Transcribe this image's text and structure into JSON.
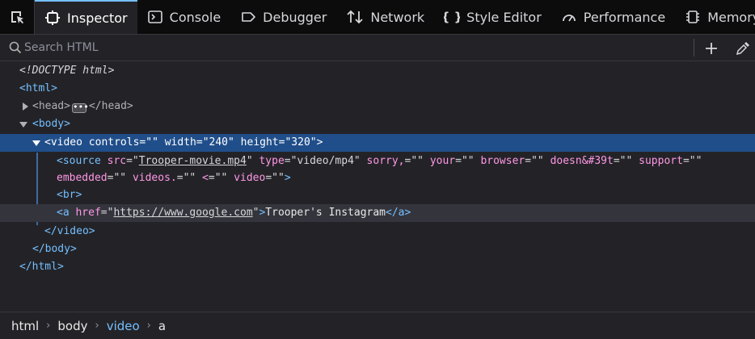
{
  "tabs": [
    {
      "label": "Inspector",
      "icon": "inspector-icon",
      "selected": true
    },
    {
      "label": "Console",
      "icon": "console-icon"
    },
    {
      "label": "Debugger",
      "icon": "debugger-icon"
    },
    {
      "label": "Network",
      "icon": "network-icon"
    },
    {
      "label": "Style Editor",
      "icon": "style-editor-icon"
    },
    {
      "label": "Performance",
      "icon": "performance-icon"
    },
    {
      "label": "Memory",
      "icon": "memory-icon"
    }
  ],
  "search": {
    "placeholder": "Search HTML"
  },
  "colors": {
    "accent": "#75bfff",
    "selected_row": "#204e8a",
    "attr_name": "#ff97e6",
    "background": "#232327"
  },
  "tree": {
    "doctype": "<!DOCTYPE html>",
    "html_open": "<html>",
    "head": {
      "open": "<head>",
      "ellipsis": "•••",
      "close": "</head>"
    },
    "body_open": "<body>",
    "video": {
      "tag_open": "<video",
      "attrs": [
        {
          "name": "controls",
          "value": "\"\""
        },
        {
          "name": "width",
          "value": "\"240\""
        },
        {
          "name": "height",
          "value": "\"320\""
        }
      ],
      "tag_end": ">"
    },
    "source": {
      "tag_open": "<source",
      "src_name": "src",
      "src_value": "Trooper-movie.mp4",
      "type_name": "type",
      "type_value": "\"video/mp4\"",
      "attrs_line1": [
        {
          "name": "sorry,",
          "value": "\"\""
        },
        {
          "name": "your",
          "value": "\"\""
        },
        {
          "name": "browser",
          "value": "\"\""
        },
        {
          "name": "doesn&#39t",
          "value": "\"\""
        },
        {
          "name": "support",
          "value": "\"\""
        }
      ],
      "attrs_line2": [
        {
          "name": "embedded",
          "value": "\"\""
        },
        {
          "name": "videos.",
          "value": "\"\""
        },
        {
          "name": "<",
          "value": "\"\""
        },
        {
          "name": "video",
          "value": "\"\""
        }
      ],
      "tag_end": ">"
    },
    "br": "<br>",
    "anchor": {
      "tag_open": "<a",
      "href_name": "href",
      "href_value": "https://www.google.com",
      "text": "Trooper's Instagram",
      "close": "</a>"
    },
    "video_close": "</video>",
    "body_close": "</body>",
    "html_close": "</html>"
  },
  "breadcrumbs": [
    "html",
    "body",
    "video",
    "a"
  ],
  "breadcrumb_current": "video"
}
